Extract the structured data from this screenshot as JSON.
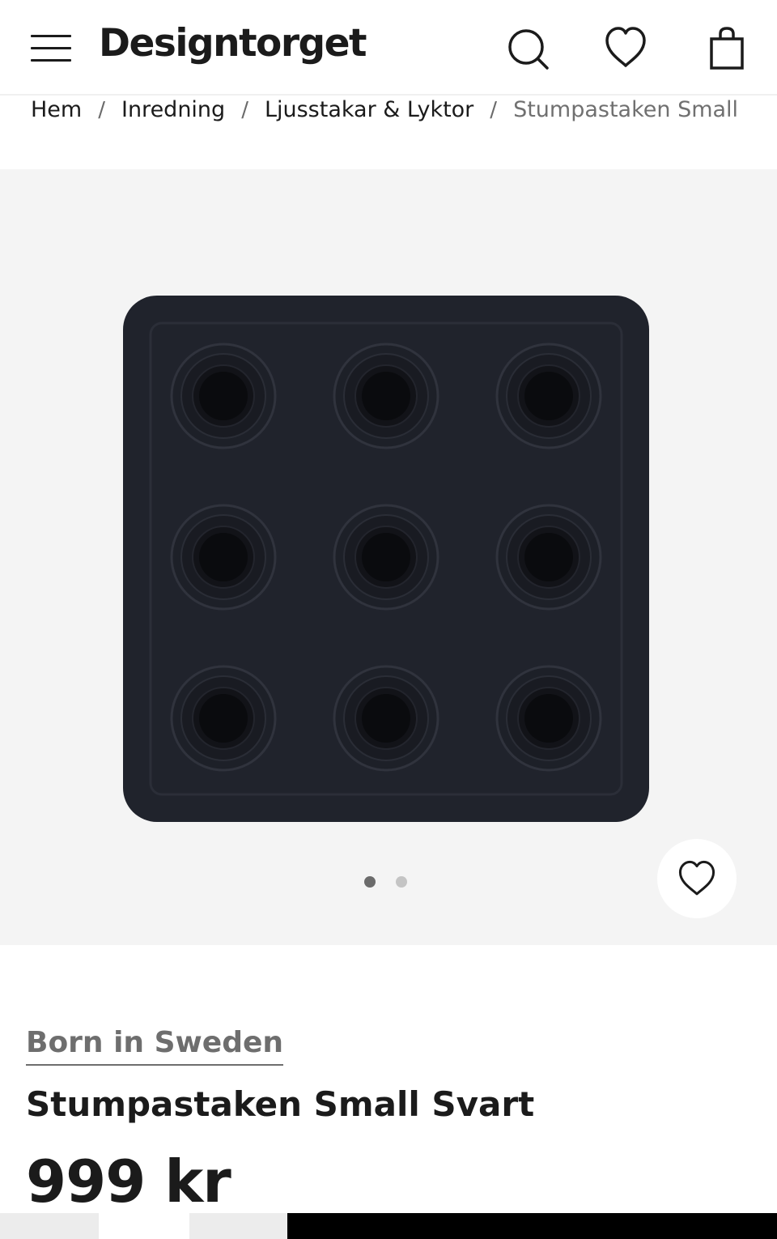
{
  "header": {
    "logo": "Designtorget",
    "icons": [
      "menu-icon",
      "search-icon",
      "heart-icon",
      "shopping-bag-icon"
    ]
  },
  "breadcrumb": {
    "items": [
      "Hem",
      "Inredning",
      "Ljusstakar & Lyktor",
      "Stumpastaken Small S"
    ],
    "separator": "/"
  },
  "gallery": {
    "slide_count": 2,
    "active_slide": 1,
    "favorite_icon": "heart-icon"
  },
  "product": {
    "brand": "Born in Sweden",
    "name": "Stumpastaken Small Svart",
    "price": "999 kr"
  },
  "colors": {
    "text": "#1b1b1b",
    "muted": "#707070",
    "gallery_bg": "#f4f4f4",
    "product": "#20232c",
    "dot_active": "#6b6b6b",
    "dot_inactive": "#c4c4c4"
  }
}
